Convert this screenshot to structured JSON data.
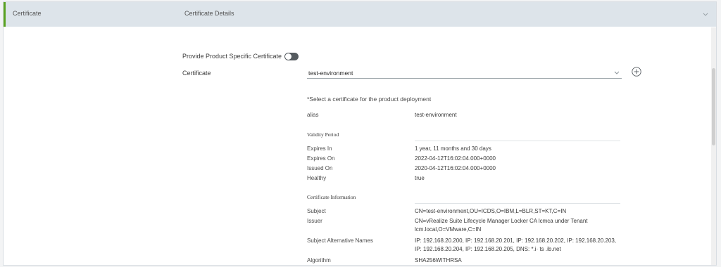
{
  "header": {
    "step_label": "Certificate",
    "title": "Certificate Details"
  },
  "form": {
    "toggle_label": "Provide Product Specific Certificate",
    "toggle_on": false,
    "certificate_label": "Certificate",
    "certificate_value": "test-environment",
    "hint": "*Select a certificate for the product deployment"
  },
  "details": {
    "alias_key": "alias",
    "alias_value": "test-environment",
    "validity_heading": "Validity Period",
    "validity": [
      {
        "key": "Expires In",
        "value": "1 year, 11 months and 30 days"
      },
      {
        "key": "Expires On",
        "value": "2022-04-12T16:02:04.000+0000"
      },
      {
        "key": "Issued On",
        "value": "2020-04-12T16:02:04.000+0000"
      },
      {
        "key": "Healthy",
        "value": "true"
      }
    ],
    "info_heading": "Certificate Information",
    "info": [
      {
        "key": "Subject",
        "value": "CN=test-environment,OU=ICDS,O=IBM,L=BLR,ST=KT,C=IN"
      },
      {
        "key": "Issuer",
        "value": "CN=vRealize Suite Lifecycle Manager Locker CA lcmca under Tenant lcm.local,O=VMware,C=IN"
      },
      {
        "key": "Subject Alternative Names",
        "value": "IP: 192.168.20.200, IP: 192.168.20.201, IP: 192.168.20.202, IP: 192.168.20.203, IP: 192.168.20.204, IP: 192.168.20.205, DNS: *.i· ts .ib.net"
      },
      {
        "key": "Algorithm",
        "value": "SHA256WITHRSA"
      }
    ]
  },
  "colors": {
    "accent": "#5aa220",
    "header_bg": "#dde4ea"
  }
}
